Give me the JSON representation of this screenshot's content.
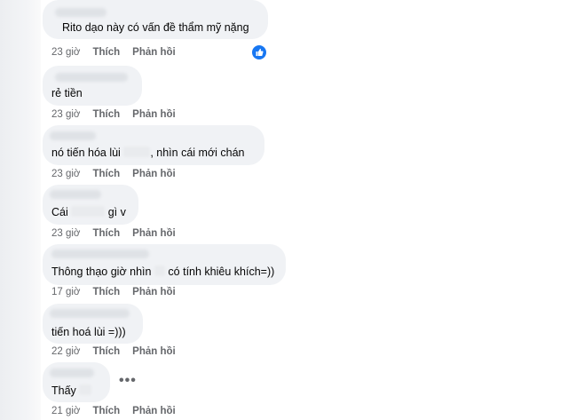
{
  "comments": [
    {
      "text_before": "Rito dạo này có vấn đề thẩm mỹ nặng",
      "time": "23 giờ",
      "like": "Thích",
      "reply": "Phản hồi",
      "reaction": "thumbs-up-icon"
    },
    {
      "text_before": "rẻ tiền",
      "time": "23 giờ",
      "like": "Thích",
      "reply": "Phản hồi"
    },
    {
      "text_before": "nó tiến hóa lùi",
      "text_after": ", nhìn cái mới chán",
      "time": "23 giờ",
      "like": "Thích",
      "reply": "Phản hồi"
    },
    {
      "text_before": "Cái",
      "text_after": "gì v",
      "time": "23 giờ",
      "like": "Thích",
      "reply": "Phản hồi"
    },
    {
      "text_before": "Thông thạo giờ nhìn",
      "text_after": "có tính khiêu khích=))",
      "time": "17 giờ",
      "like": "Thích",
      "reply": "Phản hồi"
    },
    {
      "text_before": "tiến hoá lùi =)))",
      "time": "22 giờ",
      "like": "Thích",
      "reply": "Phản hồi"
    },
    {
      "text_before": "Thấy",
      "time": "21 giờ",
      "like": "Thích",
      "reply": "Phản hồi",
      "more_icon": "•••"
    }
  ],
  "colors": {
    "bubble": "#f0f2f5",
    "meta_text": "#65676b",
    "reaction_blue": "#1877f2"
  }
}
